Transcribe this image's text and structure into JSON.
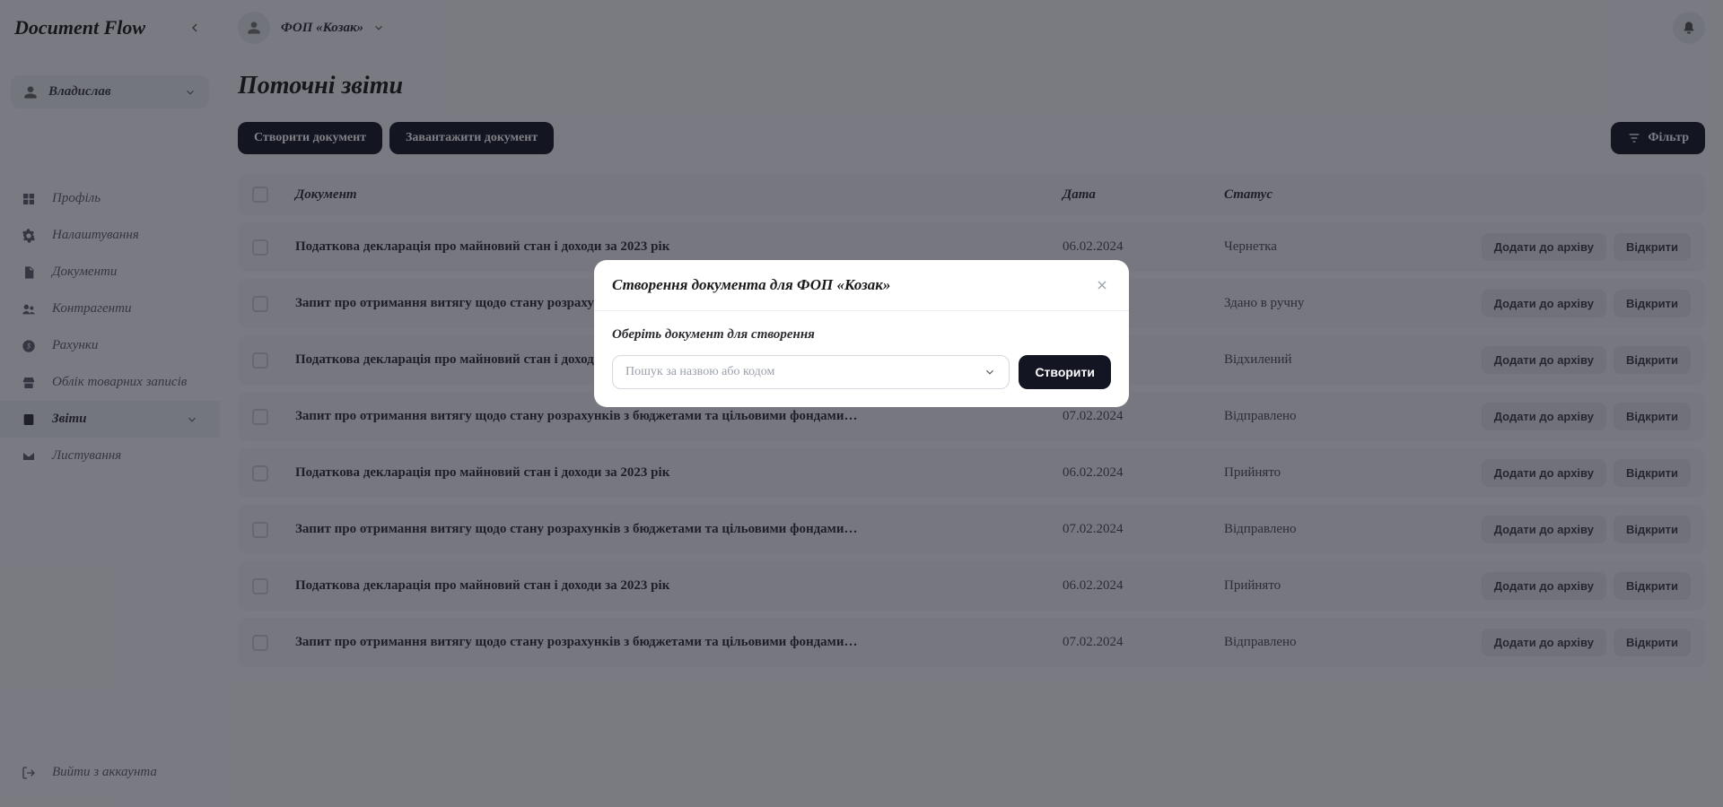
{
  "app": {
    "name": "Document Flow"
  },
  "user": {
    "name": "Владислав"
  },
  "org": {
    "name": "ФОП «Козак»"
  },
  "sidebar": {
    "items": [
      {
        "label": "Профіль"
      },
      {
        "label": "Налаштування"
      },
      {
        "label": "Документи"
      },
      {
        "label": "Контрагенти"
      },
      {
        "label": "Рахунки"
      },
      {
        "label": "Облік товарних записів"
      },
      {
        "label": "Звіти"
      },
      {
        "label": "Листування"
      }
    ],
    "logout": "Вийти з аккаунта"
  },
  "page": {
    "title": "Поточні звіти",
    "create": "Створити документ",
    "upload": "Завантажити документ",
    "filter": "Фільтр"
  },
  "columns": {
    "doc": "Документ",
    "date": "Дата",
    "status": "Статус"
  },
  "row_actions": {
    "archive": "Додати до архіву",
    "open": "Відкрити"
  },
  "rows": [
    {
      "name": "Податкова декларація про майновий стан і доходи за 2023 рік",
      "date": "06.02.2024",
      "status": "Чернетка"
    },
    {
      "name": "Запит про отримання витягу щодо стану розрахунків з бюджетами та цільовими фондами…",
      "date": "",
      "status": "Здано в ручну"
    },
    {
      "name": "Податкова декларація про майновий стан і доходи за 2023 рік",
      "date": "",
      "status": "Відхилений"
    },
    {
      "name": "Запит про отримання витягу щодо стану розрахунків з бюджетами та цільовими фондами…",
      "date": "07.02.2024",
      "status": "Відправлено"
    },
    {
      "name": "Податкова декларація про майновий стан і доходи за 2023 рік",
      "date": "06.02.2024",
      "status": "Прийнято"
    },
    {
      "name": "Запит про отримання витягу щодо стану розрахунків з бюджетами та цільовими фондами…",
      "date": "07.02.2024",
      "status": "Відправлено"
    },
    {
      "name": "Податкова декларація про майновий стан і доходи за 2023 рік",
      "date": "06.02.2024",
      "status": "Прийнято"
    },
    {
      "name": "Запит про отримання витягу щодо стану розрахунків з бюджетами та цільовими фондами…",
      "date": "07.02.2024",
      "status": "Відправлено"
    }
  ],
  "modal": {
    "title": "Створення документа для ФОП «Козак»",
    "label": "Оберіть документ для створення",
    "placeholder": "Пошук за назвою або кодом",
    "submit": "Створити"
  }
}
